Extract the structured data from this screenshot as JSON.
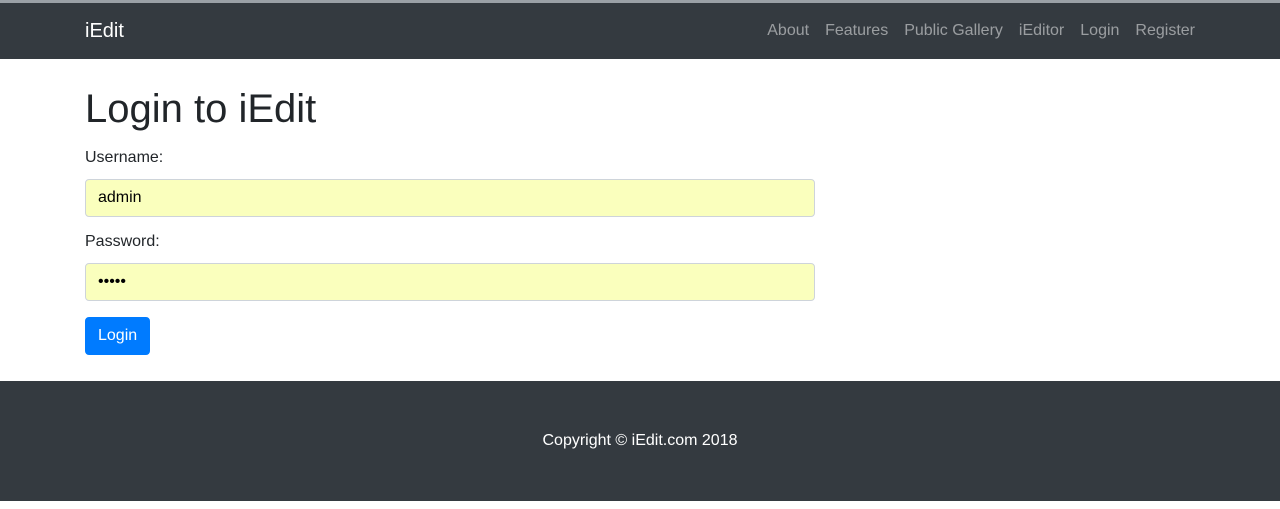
{
  "brand": "iEdit",
  "nav": {
    "about": "About",
    "features": "Features",
    "gallery": "Public Gallery",
    "ieditor": "iEditor",
    "login": "Login",
    "register": "Register"
  },
  "page": {
    "title": "Login to iEdit"
  },
  "form": {
    "username_label": "Username:",
    "username_value": "admin",
    "password_label": "Password:",
    "password_value": "admin",
    "submit_label": "Login"
  },
  "footer": {
    "copyright": "Copyright © iEdit.com 2018"
  },
  "colors": {
    "navbar_bg": "#343a40",
    "autofill_bg": "#faffbd",
    "primary": "#007bff"
  }
}
